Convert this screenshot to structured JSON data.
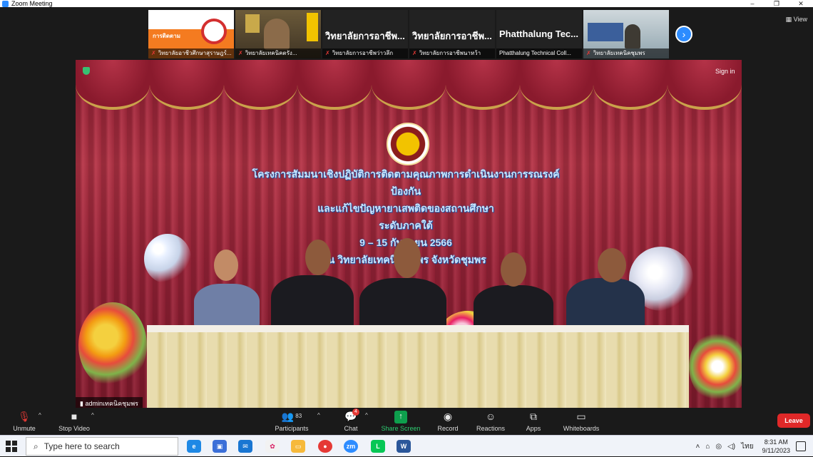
{
  "window": {
    "title": "Zoom Meeting",
    "controls": [
      "–",
      "❐",
      "✕"
    ]
  },
  "view_label": "View",
  "participants_strip": [
    {
      "name": "วิทยาลัยอาชีวศึกษาสุราษฎร์...",
      "muted": true,
      "kind": "poster",
      "poster_text": "การติดตาม"
    },
    {
      "name": "วิทยาลัยเทคนิคตรัง...",
      "muted": true,
      "kind": "camera"
    },
    {
      "name": "วิทยาลัยการอาชีพว่าวลึก",
      "muted": true,
      "kind": "text",
      "big_text": "วิทยาลัยการอาชีพ..."
    },
    {
      "name": "วิทยาลัยการอาชีพนาหว้า",
      "muted": true,
      "kind": "text",
      "big_text": "วิทยาลัยการอาชีพ..."
    },
    {
      "name": "Phatthalung Technical Coll...",
      "muted": false,
      "kind": "text",
      "big_text": "Phatthalung  Tec..."
    },
    {
      "name": "วิทยาลัยเทคนิคชุมพร",
      "muted": true,
      "kind": "camera2"
    }
  ],
  "main_video": {
    "signin_label": "Sign in",
    "banner_lines": [
      "โครงการสัมมนาเชิงปฏิบัติการติดตามคุณภาพการดำเนินงานการรณรงค์ป้องกัน",
      "และแก้ไขปัญหายาเสพติดของสถานศึกษา",
      "ระดับภาคใต้",
      "9  –  15  กันยายน  2566",
      "ณ  วิทยาลัยเทคนิคชุมพร   จังหวัดชุมพร"
    ],
    "speaker_label": "adminเทคนิคชุมพร"
  },
  "toolbar": {
    "unmute": "Unmute",
    "stop_video": "Stop Video",
    "participants": "Participants",
    "participants_count": "83",
    "chat": "Chat",
    "chat_badge": "4",
    "share_screen": "Share Screen",
    "record": "Record",
    "reactions": "Reactions",
    "apps": "Apps",
    "whiteboards": "Whiteboards",
    "leave": "Leave"
  },
  "taskbar": {
    "search_placeholder": "Type here to search",
    "apps": [
      "edge",
      "store",
      "mail",
      "paint",
      "explorer",
      "chrome",
      "zoom",
      "line",
      "word"
    ],
    "language": "ไทย",
    "time": "8:31 AM",
    "date": "9/11/2023"
  },
  "colors": {
    "zoom_blue": "#2d8cff",
    "leave_red": "#e02828",
    "share_green": "#0e9f4d"
  }
}
